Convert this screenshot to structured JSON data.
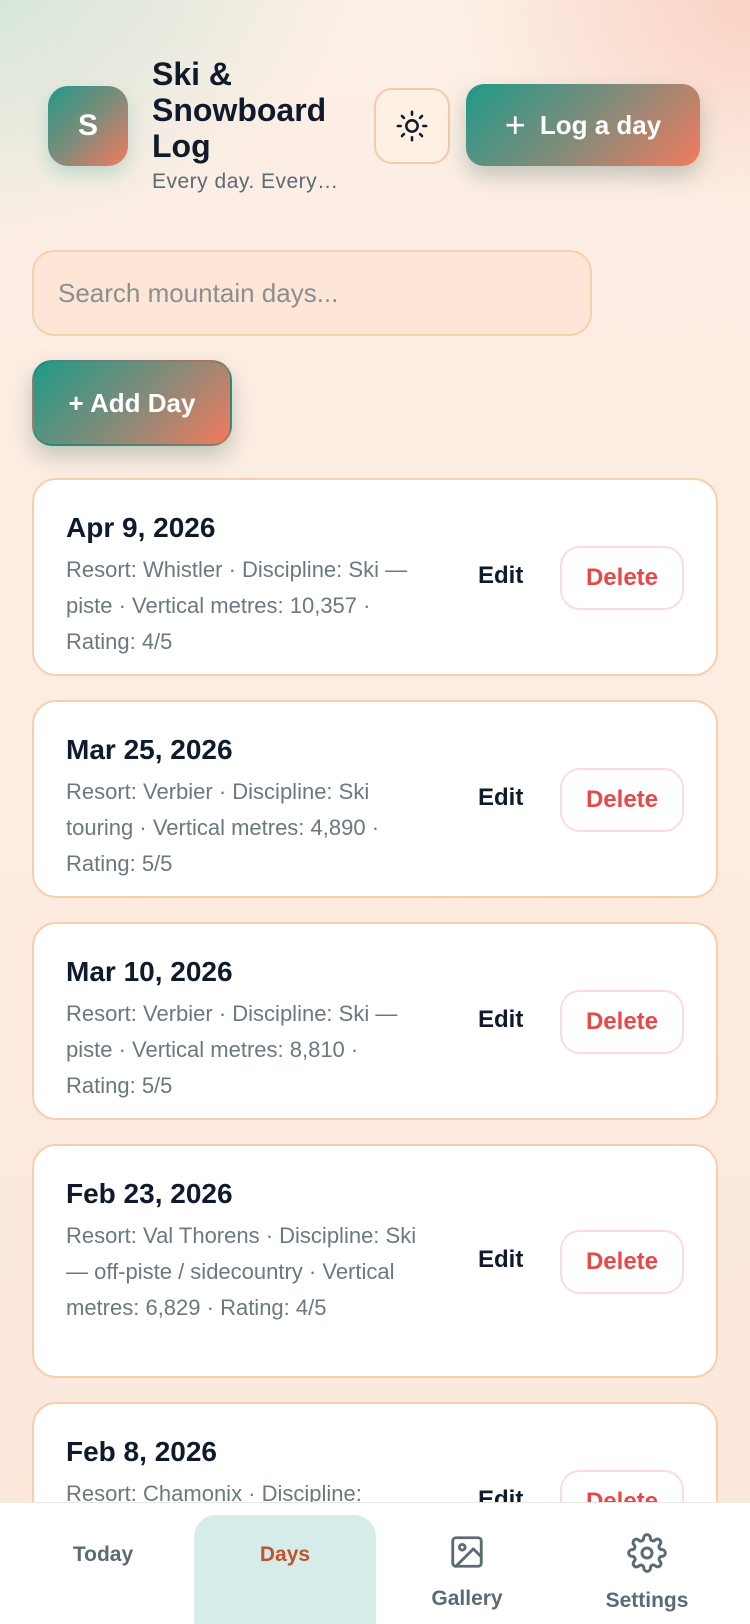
{
  "header": {
    "avatar_letter": "S",
    "title": "Ski & Snowboard Log",
    "subtitle": "Every day. Every…",
    "log_button": "Log a day",
    "log_button_plus": "+"
  },
  "search": {
    "placeholder": "Search mountain days..."
  },
  "add_day_button": "+ Add Day",
  "entries": [
    {
      "date": "Apr 9, 2026",
      "meta": "Resort: Whistler · Discipline: Ski — piste · Vertical metres: 10,357 · Rating: 4/5",
      "edit": "Edit",
      "delete": "Delete"
    },
    {
      "date": "Mar 25, 2026",
      "meta": "Resort: Verbier · Discipline: Ski touring · Vertical metres: 4,890 · Rating: 5/5",
      "edit": "Edit",
      "delete": "Delete"
    },
    {
      "date": "Mar 10, 2026",
      "meta": "Resort: Verbier · Discipline: Ski — piste · Vertical metres: 8,810 · Rating: 5/5",
      "edit": "Edit",
      "delete": "Delete"
    },
    {
      "date": "Feb 23, 2026",
      "meta": "Resort: Val Thorens · Discipline: Ski — off-piste / sidecountry · Vertical metres: 6,829 · Rating: 4/5",
      "edit": "Edit",
      "delete": "Delete"
    },
    {
      "date": "Feb 8, 2026",
      "meta": "Resort: Chamonix · Discipline:",
      "edit": "Edit",
      "delete": "Delete"
    }
  ],
  "nav": {
    "today": "Today",
    "days": "Days",
    "gallery": "Gallery",
    "settings": "Settings"
  },
  "icons": {
    "theme": "sun-icon",
    "gallery": "image-icon",
    "settings": "gear-icon"
  },
  "colors": {
    "accent_teal": "#1f9a89",
    "accent_coral": "#f47a5e",
    "delete_red": "#e84848",
    "active_nav_text": "#c2532c"
  }
}
